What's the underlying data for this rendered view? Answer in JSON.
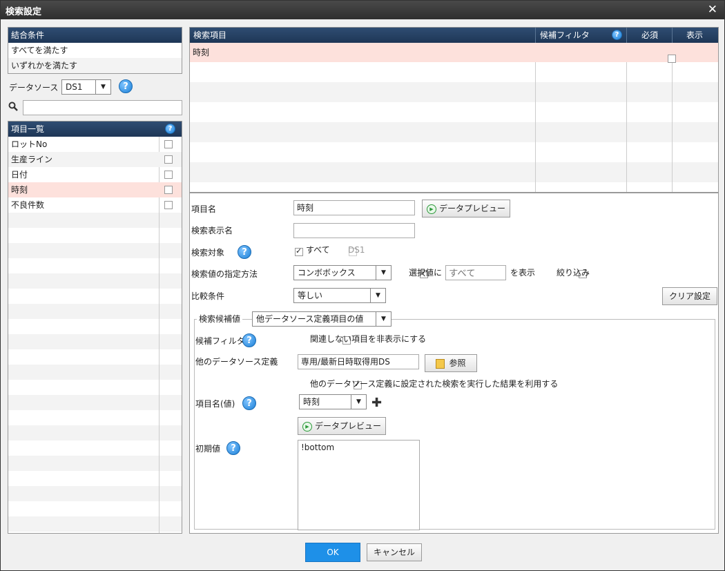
{
  "dialog": {
    "title": "検索設定"
  },
  "join": {
    "header": "結合条件",
    "options": [
      "すべてを満たす",
      "いずれかを満たす"
    ]
  },
  "datasource": {
    "label": "データソース",
    "value": "DS1"
  },
  "search": {
    "placeholder": ""
  },
  "items": {
    "header": "項目一覧",
    "rows": [
      {
        "name": "ロットNo",
        "checked": false
      },
      {
        "name": "生産ライン",
        "checked": false
      },
      {
        "name": "日付",
        "checked": false
      },
      {
        "name": "時刻",
        "checked": false
      },
      {
        "name": "不良件数",
        "checked": false
      }
    ]
  },
  "search_items": {
    "headers": {
      "item": "検索項目",
      "filter": "候補フィルタ",
      "required": "必須",
      "display": "表示"
    },
    "rows": [
      {
        "item": "時刻",
        "filter": "",
        "required": false,
        "display": true
      }
    ]
  },
  "form": {
    "item_name_label": "項目名",
    "item_name_value": "時刻",
    "data_preview": "データプレビュー",
    "display_name_label": "検索表示名",
    "display_name_value": "",
    "target_label": "検索対象",
    "target_all": "すべて",
    "target_ds1": "DS1",
    "method_label": "検索値の指定方法",
    "method_value": "コンボボックス",
    "selected_value_label": "選択値に",
    "selected_value_placeholder": "すべて",
    "show_label": "を表示",
    "narrow_label": "絞り込み",
    "compare_label": "比較条件",
    "compare_value": "等しい",
    "clear_button": "クリア設定"
  },
  "candidates": {
    "legend_label": "検索候補値",
    "legend_value": "他データソース定義項目の値",
    "filter_label": "候補フィルタ",
    "filter_option": "関連しない項目を非表示にする",
    "other_ds_label": "他のデータソース定義",
    "other_ds_value": "専用/最新日時取得用DS",
    "browse_button": "参照",
    "use_result": "他のデータソース定義に設定された検索を実行した結果を利用する",
    "item_value_label": "項目名(値)",
    "item_value": "時刻",
    "preview_button": "データプレビュー",
    "initial_label": "初期値",
    "initial_value": "!bottom"
  },
  "footer": {
    "ok": "OK",
    "cancel": "キャンセル"
  },
  "colors": {
    "header_bg": "#1e3656",
    "selection": "#fde1dc",
    "ok_button": "#1e90e8"
  }
}
